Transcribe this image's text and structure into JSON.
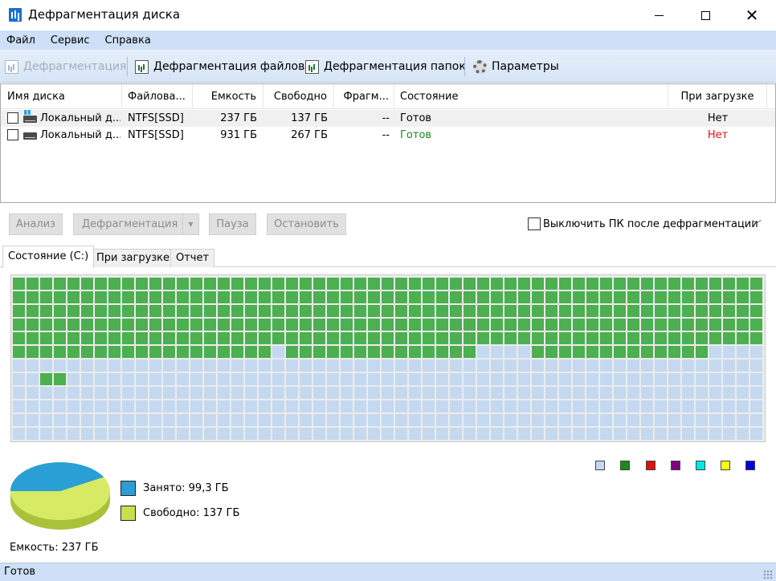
{
  "window": {
    "title": "Дефрагментация диска"
  },
  "menu": [
    "Файл",
    "Сервис",
    "Справка"
  ],
  "toolbar": {
    "defrag": "Дефрагментация",
    "defrag_files": "Дефрагментация файлов",
    "defrag_folders": "Дефрагментация папок",
    "settings": "Параметры"
  },
  "disk_table": {
    "columns": [
      "Имя диска",
      "Файлова...",
      "Емкость",
      "Свободно",
      "Фрагм...",
      "Состояние",
      "При загрузке"
    ],
    "rows": [
      {
        "name": "Локальный д...",
        "fs": "NTFS[SSD]",
        "capacity": "237 ГБ",
        "free": "137 ГБ",
        "frag": "--",
        "state": "Готов",
        "boot": "Нет",
        "state_color": "#000000",
        "boot_color": "#000000"
      },
      {
        "name": "Локальный д...",
        "fs": "NTFS[SSD]",
        "capacity": "931 ГБ",
        "free": "267 ГБ",
        "frag": "--",
        "state": "Готов",
        "boot": "Нет",
        "state_color": "#1a8a1a",
        "boot_color": "#e01010"
      }
    ]
  },
  "actions": {
    "analyze": "Анализ",
    "defrag": "Дефрагментация",
    "pause": "Пауза",
    "stop": "Остановить",
    "shutdown_label": "Выключить ПК после дефрагментации"
  },
  "tabs": [
    "Состояние (C:)",
    "При загрузке",
    "Отчет"
  ],
  "cluster_map": {
    "rows": 12,
    "cols": 55,
    "colors": {
      "used": "#4caf50",
      "free": "#c4d9ef"
    },
    "used_rows_full": 5,
    "row5_used_cols": [
      0,
      1,
      2,
      3,
      4,
      5,
      6,
      7,
      8,
      9,
      10,
      11,
      12,
      13,
      14,
      15,
      16,
      17,
      18,
      20,
      21,
      22,
      23,
      24,
      25,
      26,
      27,
      28,
      29,
      30,
      31,
      32,
      33,
      38,
      39,
      40,
      41,
      42,
      43,
      44,
      45,
      46,
      47,
      48,
      49,
      50
    ],
    "extra_used": [
      [
        7,
        2
      ],
      [
        7,
        3
      ]
    ]
  },
  "legend_colors": [
    "#c4d9ef",
    "#1a8a1a",
    "#e01010",
    "#800080",
    "#00e6e6",
    "#ffff00",
    "#0000e0"
  ],
  "stats": {
    "used_label": "Занято: 99,3 ГБ",
    "free_label": "Свободно: 137 ГБ",
    "used_color": "#2a9fd6",
    "free_color": "#c8e04a",
    "used_fraction": 0.419,
    "capacity_label": "Емкость: 237 ГБ"
  },
  "status": {
    "text": "Готов"
  }
}
